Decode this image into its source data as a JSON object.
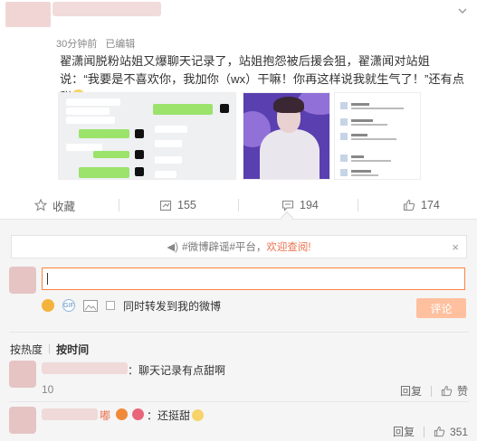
{
  "post": {
    "time": "30分钟前",
    "edited": "已编辑",
    "text": "翟潇闻脱粉站姐又爆聊天记录了，站姐抱怨被后援会狙，翟潇闻对站姐说：“我要是不喜欢你，我加你（wx）干嘛！你再这样说我就生气了！”还有点甜",
    "emoji_icon": "blush-emoji-icon"
  },
  "actions": {
    "favorite_label": "收藏",
    "repost_count": "155",
    "comment_count": "194",
    "like_count": "174"
  },
  "comment_box": {
    "notice_prefix": "#微博辟谣#平台，",
    "notice_link": "欢迎查阅!",
    "close": "×",
    "input_value": "",
    "also_repost_label": "同时转发到我的微博",
    "submit_label": "评论"
  },
  "sort": {
    "hot": "按热度",
    "time": "按时间"
  },
  "comments": [
    {
      "text": "：聊天记录有点甜啊",
      "time_partial": "10",
      "reply_label": "回复",
      "like_label": "赞"
    },
    {
      "prefix": "嘟",
      "text": "：还挺甜",
      "reply_label": "回复",
      "like_count": "351"
    }
  ],
  "colors": {
    "accent": "#eb7350",
    "input_border": "#ff8140",
    "submit_bg": "#ffc09f"
  }
}
